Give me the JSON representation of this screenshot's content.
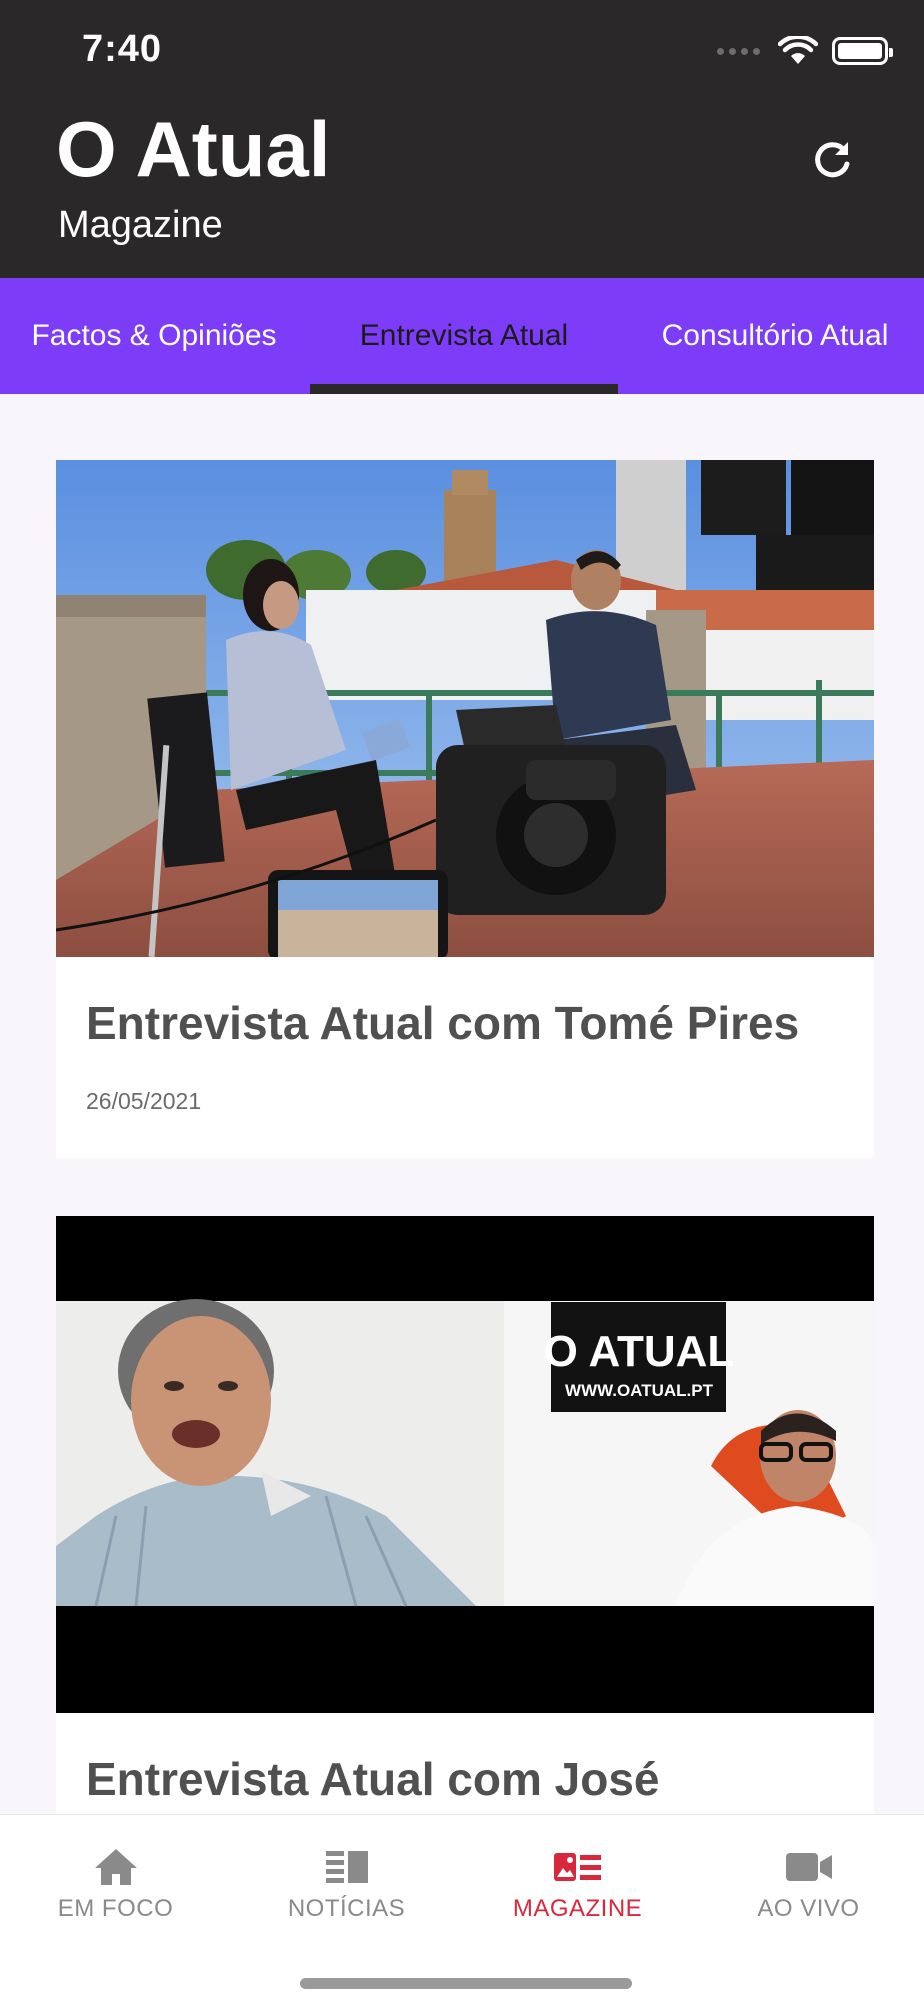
{
  "status_bar": {
    "time": "7:40",
    "icons": [
      "signal-icon",
      "wifi-icon",
      "battery-icon"
    ]
  },
  "header": {
    "title": "O Atual",
    "subtitle": "Magazine",
    "refresh_icon": "refresh-icon",
    "background": "#2a2828"
  },
  "tabs": {
    "background": "#7c3cf8",
    "items": [
      {
        "label": "Factos & Opiniões",
        "active": false
      },
      {
        "label": "Entrevista Atual",
        "active": true
      },
      {
        "label": "Consultório Atual",
        "active": false
      }
    ]
  },
  "feed": {
    "cards": [
      {
        "title": "Entrevista Atual com Tomé Pires",
        "date": "26/05/2021",
        "image": "interview-on-terrace-with-camera"
      },
      {
        "title": "Entrevista Atual com José",
        "image": "video-call-split-screen",
        "image_text_1": "O ATUAL",
        "image_text_2": "WWW.OATUAL.PT"
      }
    ]
  },
  "bottom_nav": {
    "active_color": "#d9283c",
    "items": [
      {
        "label": "EM FOCO",
        "icon": "home-icon",
        "active": false
      },
      {
        "label": "NOTÍCIAS",
        "icon": "news-icon",
        "active": false
      },
      {
        "label": "MAGAZINE",
        "icon": "magazine-icon",
        "active": true
      },
      {
        "label": "AO VIVO",
        "icon": "video-camera-icon",
        "active": false
      }
    ]
  }
}
